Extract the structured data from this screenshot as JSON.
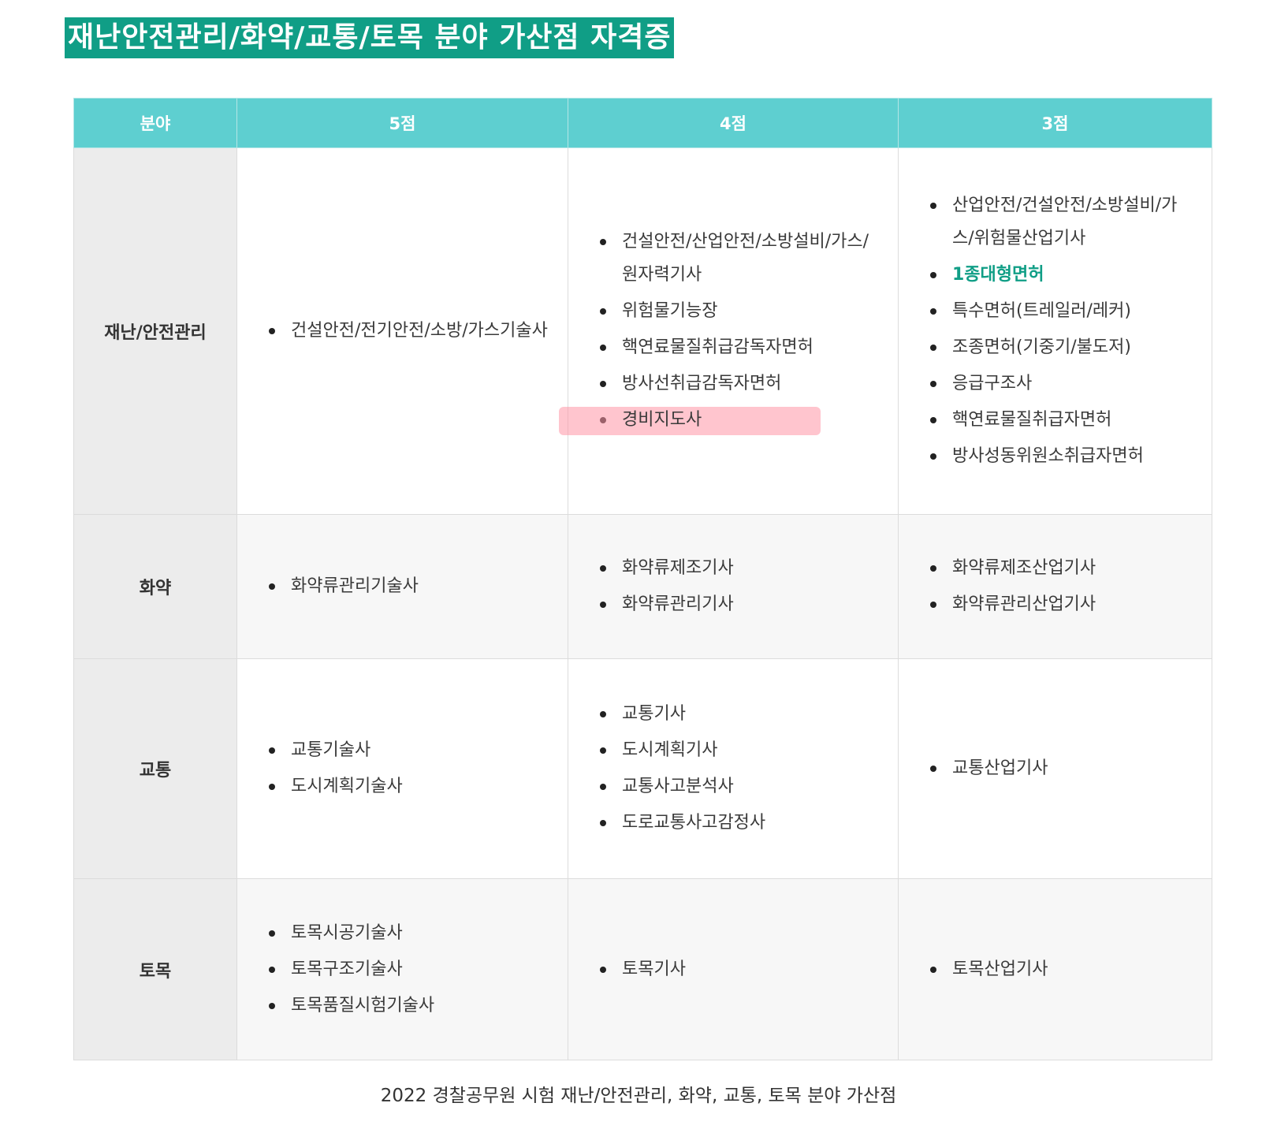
{
  "title": "재난안전관리/화약/교통/토목 분야 가산점 자격증",
  "table": {
    "headers": [
      "분야",
      "5점",
      "4점",
      "3점"
    ],
    "rows": [
      {
        "category": "재난/안전관리",
        "five": [
          "건설안전/전기안전/소방/가스기술사"
        ],
        "four": [
          "건설안전/산업안전/소방설비/가스/원자력기사",
          "위험물기능장",
          "핵연료물질취급감독자면허",
          "방사선취급감독자면허",
          "경비지도사"
        ],
        "three": [
          "산업안전/건설안전/소방설비/가스/위험물산업기사",
          "1종대형면허",
          "특수면허(트레일러/레커)",
          "조종면허(기중기/불도저)",
          "응급구조사",
          "핵연료물질취급자면허",
          "방사성동위원소취급자면허"
        ]
      },
      {
        "category": "화약",
        "five": [
          "화약류관리기술사"
        ],
        "four": [
          "화약류제조기사",
          "화약류관리기사"
        ],
        "three": [
          "화약류제조산업기사",
          "화약류관리산업기사"
        ]
      },
      {
        "category": "교통",
        "five": [
          "교통기술사",
          "도시계획기술사"
        ],
        "four": [
          "교통기사",
          "도시계획기사",
          "교통사고분석사",
          "도로교통사고감정사"
        ],
        "three": [
          "교통산업기사"
        ]
      },
      {
        "category": "토목",
        "five": [
          "토목시공기술사",
          "토목구조기술사",
          "토목품질시험기술사"
        ],
        "four": [
          "토목기사"
        ],
        "three": [
          "토목산업기사"
        ]
      }
    ]
  },
  "caption": "2022 경찰공무원 시험 재난/안전관리, 화약, 교통, 토목 분야 가산점",
  "colors": {
    "title_bg": "#109e86",
    "header_bg": "#5ecfd0",
    "highlight_green": "#109e86",
    "highlight_pink": "#ffb3bd"
  }
}
